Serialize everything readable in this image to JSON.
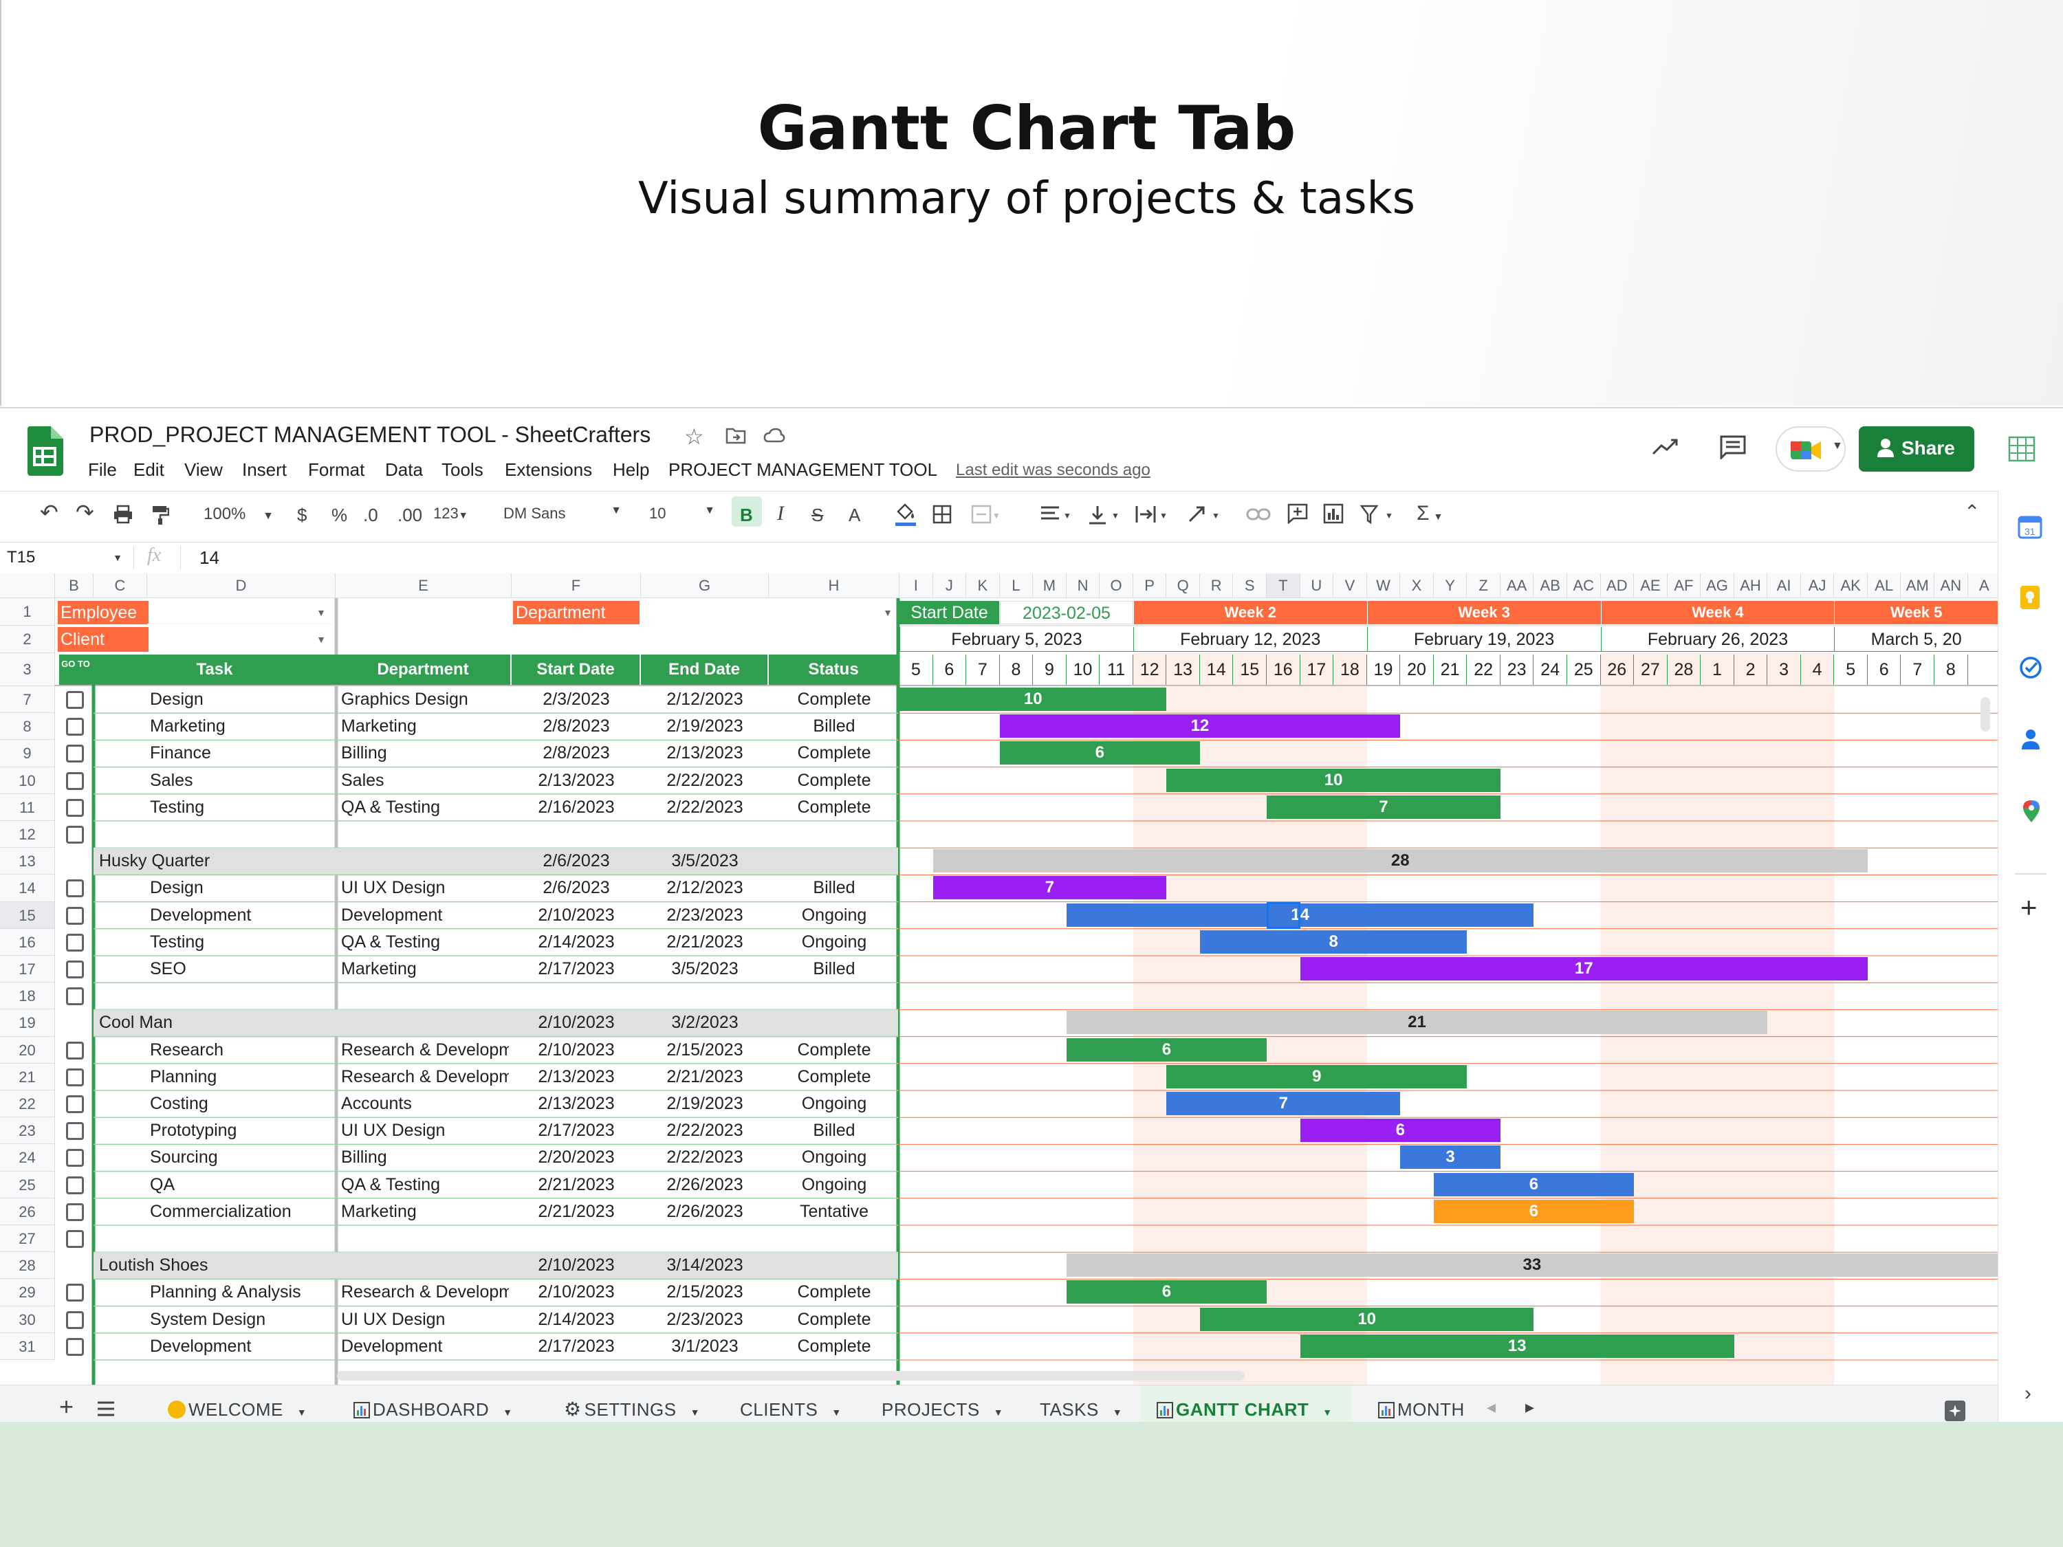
{
  "banner": {
    "title": "Gantt Chart Tab",
    "subtitle": "Visual summary of projects & tasks"
  },
  "doc": {
    "title": "PROD_PROJECT MANAGEMENT TOOL - SheetCrafters",
    "last_edit": "Last edit was seconds ago"
  },
  "menu": [
    "File",
    "Edit",
    "View",
    "Insert",
    "Format",
    "Data",
    "Tools",
    "Extensions",
    "Help",
    "PROJECT MANAGEMENT TOOL"
  ],
  "share_label": "Share",
  "toolbar": {
    "zoom": "100%",
    "currency": "$",
    "percent": "%",
    "dec_dec": ".0",
    "dec_inc": ".00",
    "num_fmt": "123",
    "font": "DM Sans",
    "size": "10",
    "bold": "B",
    "italic": "I",
    "strike": "S",
    "textcolor": "A"
  },
  "formula": {
    "cell_ref": "T15",
    "fx": "fx",
    "value": "14"
  },
  "columns": [
    "B",
    "C",
    "D",
    "E",
    "F",
    "G",
    "H",
    "I",
    "J",
    "K",
    "L",
    "M",
    "N",
    "O",
    "P",
    "Q",
    "R",
    "S",
    "T",
    "U",
    "V",
    "W",
    "X",
    "Y",
    "Z",
    "AA",
    "AB",
    "AC",
    "AD",
    "AE",
    "AF",
    "AG",
    "AH",
    "AI",
    "AJ",
    "AK",
    "AL",
    "AM",
    "AN",
    "A"
  ],
  "filters": {
    "employee_label": "Employee",
    "client_label": "Client",
    "department_label": "Department",
    "start_date_label": "Start Date",
    "start_date_value": "2023-02-05"
  },
  "weeks": [
    {
      "label": "",
      "date": "February 5, 2023"
    },
    {
      "label": "Week 2",
      "date": "February 12, 2023"
    },
    {
      "label": "Week 3",
      "date": "February 19, 2023"
    },
    {
      "label": "Week 4",
      "date": "February 26, 2023"
    },
    {
      "label": "Week 5",
      "date": "March 5, 20"
    }
  ],
  "days": [
    "5",
    "6",
    "7",
    "8",
    "9",
    "10",
    "11",
    "12",
    "13",
    "14",
    "15",
    "16",
    "17",
    "18",
    "19",
    "20",
    "21",
    "22",
    "23",
    "24",
    "25",
    "26",
    "27",
    "28",
    "1",
    "2",
    "3",
    "4",
    "5",
    "6",
    "7",
    "8"
  ],
  "headers": {
    "goto": "GO TO",
    "task": "Task",
    "department": "Department",
    "start": "Start Date",
    "end": "End Date",
    "status": "Status"
  },
  "rows": [
    {
      "num": "7",
      "type": "task",
      "task": "Design",
      "dept": "Graphics Design",
      "start": "2/3/2023",
      "end": "2/12/2023",
      "status": "Complete",
      "bar": {
        "from": 0,
        "span": 8,
        "label": "10",
        "kind": "Complete"
      }
    },
    {
      "num": "8",
      "type": "task",
      "task": "Marketing",
      "dept": "Marketing",
      "start": "2/8/2023",
      "end": "2/19/2023",
      "status": "Billed",
      "bar": {
        "from": 3,
        "span": 12,
        "label": "12",
        "kind": "Billed"
      }
    },
    {
      "num": "9",
      "type": "task",
      "task": "Finance",
      "dept": "Billing",
      "start": "2/8/2023",
      "end": "2/13/2023",
      "status": "Complete",
      "bar": {
        "from": 3,
        "span": 6,
        "label": "6",
        "kind": "Complete"
      }
    },
    {
      "num": "10",
      "type": "task",
      "task": "Sales",
      "dept": "Sales",
      "start": "2/13/2023",
      "end": "2/22/2023",
      "status": "Complete",
      "bar": {
        "from": 8,
        "span": 10,
        "label": "10",
        "kind": "Complete"
      }
    },
    {
      "num": "11",
      "type": "task",
      "task": "Testing",
      "dept": "QA & Testing",
      "start": "2/16/2023",
      "end": "2/22/2023",
      "status": "Complete",
      "bar": {
        "from": 11,
        "span": 7,
        "label": "7",
        "kind": "Complete"
      }
    },
    {
      "num": "12",
      "type": "empty"
    },
    {
      "num": "13",
      "type": "project",
      "task": "Husky Quarter",
      "start": "2/6/2023",
      "end": "3/5/2023",
      "bar": {
        "from": 1,
        "span": 28,
        "label": "28",
        "kind": "Project"
      }
    },
    {
      "num": "14",
      "type": "task",
      "task": "Design",
      "dept": "UI UX Design",
      "start": "2/6/2023",
      "end": "2/12/2023",
      "status": "Billed",
      "bar": {
        "from": 1,
        "span": 7,
        "label": "7",
        "kind": "Billed"
      }
    },
    {
      "num": "15",
      "type": "task",
      "task": "Development",
      "dept": "Development",
      "start": "2/10/2023",
      "end": "2/23/2023",
      "status": "Ongoing",
      "bar": {
        "from": 5,
        "span": 14,
        "label": "14",
        "kind": "Ongoing"
      }
    },
    {
      "num": "16",
      "type": "task",
      "task": "Testing",
      "dept": "QA & Testing",
      "start": "2/14/2023",
      "end": "2/21/2023",
      "status": "Ongoing",
      "bar": {
        "from": 9,
        "span": 8,
        "label": "8",
        "kind": "Ongoing"
      }
    },
    {
      "num": "17",
      "type": "task",
      "task": "SEO",
      "dept": "Marketing",
      "start": "2/17/2023",
      "end": "3/5/2023",
      "status": "Billed",
      "bar": {
        "from": 12,
        "span": 17,
        "label": "17",
        "kind": "Billed"
      }
    },
    {
      "num": "18",
      "type": "empty"
    },
    {
      "num": "19",
      "type": "project",
      "task": "Cool Man",
      "start": "2/10/2023",
      "end": "3/2/2023",
      "bar": {
        "from": 5,
        "span": 21,
        "label": "21",
        "kind": "Project"
      }
    },
    {
      "num": "20",
      "type": "task",
      "task": "Research",
      "dept": "Research & Developm",
      "start": "2/10/2023",
      "end": "2/15/2023",
      "status": "Complete",
      "bar": {
        "from": 5,
        "span": 6,
        "label": "6",
        "kind": "Complete"
      }
    },
    {
      "num": "21",
      "type": "task",
      "task": "Planning",
      "dept": "Research & Developm",
      "start": "2/13/2023",
      "end": "2/21/2023",
      "status": "Complete",
      "bar": {
        "from": 8,
        "span": 9,
        "label": "9",
        "kind": "Complete"
      }
    },
    {
      "num": "22",
      "type": "task",
      "task": "Costing",
      "dept": "Accounts",
      "start": "2/13/2023",
      "end": "2/19/2023",
      "status": "Ongoing",
      "bar": {
        "from": 8,
        "span": 7,
        "label": "7",
        "kind": "Ongoing"
      }
    },
    {
      "num": "23",
      "type": "task",
      "task": "Prototyping",
      "dept": "UI UX Design",
      "start": "2/17/2023",
      "end": "2/22/2023",
      "status": "Billed",
      "bar": {
        "from": 12,
        "span": 6,
        "label": "6",
        "kind": "Billed"
      }
    },
    {
      "num": "24",
      "type": "task",
      "task": "Sourcing",
      "dept": "Billing",
      "start": "2/20/2023",
      "end": "2/22/2023",
      "status": "Ongoing",
      "bar": {
        "from": 15,
        "span": 3,
        "label": "3",
        "kind": "Ongoing"
      }
    },
    {
      "num": "25",
      "type": "task",
      "task": "QA",
      "dept": "QA & Testing",
      "start": "2/21/2023",
      "end": "2/26/2023",
      "status": "Ongoing",
      "bar": {
        "from": 16,
        "span": 6,
        "label": "6",
        "kind": "Ongoing"
      }
    },
    {
      "num": "26",
      "type": "task",
      "task": "Commercialization",
      "dept": "Marketing",
      "start": "2/21/2023",
      "end": "2/26/2023",
      "status": "Tentative",
      "bar": {
        "from": 16,
        "span": 6,
        "label": "6",
        "kind": "Tentative"
      }
    },
    {
      "num": "27",
      "type": "empty"
    },
    {
      "num": "28",
      "type": "project",
      "task": "Loutish Shoes",
      "start": "2/10/2023",
      "end": "3/14/2023",
      "bar": {
        "from": 5,
        "span": 28,
        "label": "33",
        "kind": "Project"
      }
    },
    {
      "num": "29",
      "type": "task",
      "task": "Planning & Analysis",
      "dept": "Research & Developm",
      "start": "2/10/2023",
      "end": "2/15/2023",
      "status": "Complete",
      "bar": {
        "from": 5,
        "span": 6,
        "label": "6",
        "kind": "Complete"
      }
    },
    {
      "num": "30",
      "type": "task",
      "task": "System Design",
      "dept": "UI UX Design",
      "start": "2/14/2023",
      "end": "2/23/2023",
      "status": "Complete",
      "bar": {
        "from": 9,
        "span": 10,
        "label": "10",
        "kind": "Complete"
      }
    },
    {
      "num": "31",
      "type": "task",
      "task": "Development",
      "dept": "Development",
      "start": "2/17/2023",
      "end": "3/1/2023",
      "status": "Complete",
      "bar": {
        "from": 12,
        "span": 13,
        "label": "13",
        "kind": "Complete"
      }
    }
  ],
  "status_colors": {
    "Complete": "#2f9e4f",
    "Billed": "#9a1ff2",
    "Ongoing": "#3b78db",
    "Tentative": "#ff9b1a",
    "Project": "#cccccc"
  },
  "accent": {
    "green": "#2f9e4f",
    "orange": "#ff6b3d",
    "week_shade": "#fdeee9"
  },
  "tabs": [
    {
      "label": "WELCOME",
      "icon": "smile-icon",
      "active": false
    },
    {
      "label": "DASHBOARD",
      "icon": "chart-icon",
      "active": false
    },
    {
      "label": "SETTINGS",
      "icon": "gear-icon",
      "active": false
    },
    {
      "label": "CLIENTS",
      "icon": "",
      "active": false
    },
    {
      "label": "PROJECTS",
      "icon": "",
      "active": false
    },
    {
      "label": "TASKS",
      "icon": "",
      "active": false
    },
    {
      "label": "GANTT CHART",
      "icon": "chart-icon",
      "active": true
    },
    {
      "label": "MONTH",
      "icon": "chart-icon",
      "active": false
    }
  ]
}
